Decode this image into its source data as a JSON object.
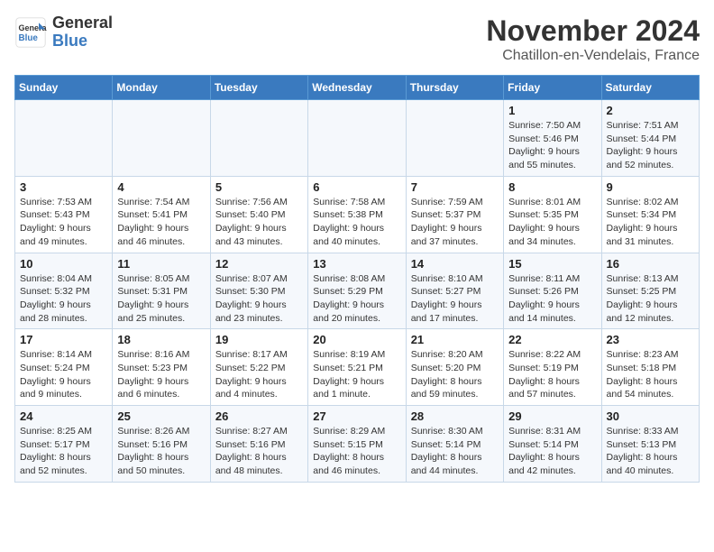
{
  "header": {
    "logo_line1": "General",
    "logo_line2": "Blue",
    "month": "November 2024",
    "location": "Chatillon-en-Vendelais, France"
  },
  "weekdays": [
    "Sunday",
    "Monday",
    "Tuesday",
    "Wednesday",
    "Thursday",
    "Friday",
    "Saturday"
  ],
  "weeks": [
    [
      {
        "day": "",
        "sunrise": "",
        "sunset": "",
        "daylight": ""
      },
      {
        "day": "",
        "sunrise": "",
        "sunset": "",
        "daylight": ""
      },
      {
        "day": "",
        "sunrise": "",
        "sunset": "",
        "daylight": ""
      },
      {
        "day": "",
        "sunrise": "",
        "sunset": "",
        "daylight": ""
      },
      {
        "day": "",
        "sunrise": "",
        "sunset": "",
        "daylight": ""
      },
      {
        "day": "1",
        "sunrise": "Sunrise: 7:50 AM",
        "sunset": "Sunset: 5:46 PM",
        "daylight": "Daylight: 9 hours and 55 minutes."
      },
      {
        "day": "2",
        "sunrise": "Sunrise: 7:51 AM",
        "sunset": "Sunset: 5:44 PM",
        "daylight": "Daylight: 9 hours and 52 minutes."
      }
    ],
    [
      {
        "day": "3",
        "sunrise": "Sunrise: 7:53 AM",
        "sunset": "Sunset: 5:43 PM",
        "daylight": "Daylight: 9 hours and 49 minutes."
      },
      {
        "day": "4",
        "sunrise": "Sunrise: 7:54 AM",
        "sunset": "Sunset: 5:41 PM",
        "daylight": "Daylight: 9 hours and 46 minutes."
      },
      {
        "day": "5",
        "sunrise": "Sunrise: 7:56 AM",
        "sunset": "Sunset: 5:40 PM",
        "daylight": "Daylight: 9 hours and 43 minutes."
      },
      {
        "day": "6",
        "sunrise": "Sunrise: 7:58 AM",
        "sunset": "Sunset: 5:38 PM",
        "daylight": "Daylight: 9 hours and 40 minutes."
      },
      {
        "day": "7",
        "sunrise": "Sunrise: 7:59 AM",
        "sunset": "Sunset: 5:37 PM",
        "daylight": "Daylight: 9 hours and 37 minutes."
      },
      {
        "day": "8",
        "sunrise": "Sunrise: 8:01 AM",
        "sunset": "Sunset: 5:35 PM",
        "daylight": "Daylight: 9 hours and 34 minutes."
      },
      {
        "day": "9",
        "sunrise": "Sunrise: 8:02 AM",
        "sunset": "Sunset: 5:34 PM",
        "daylight": "Daylight: 9 hours and 31 minutes."
      }
    ],
    [
      {
        "day": "10",
        "sunrise": "Sunrise: 8:04 AM",
        "sunset": "Sunset: 5:32 PM",
        "daylight": "Daylight: 9 hours and 28 minutes."
      },
      {
        "day": "11",
        "sunrise": "Sunrise: 8:05 AM",
        "sunset": "Sunset: 5:31 PM",
        "daylight": "Daylight: 9 hours and 25 minutes."
      },
      {
        "day": "12",
        "sunrise": "Sunrise: 8:07 AM",
        "sunset": "Sunset: 5:30 PM",
        "daylight": "Daylight: 9 hours and 23 minutes."
      },
      {
        "day": "13",
        "sunrise": "Sunrise: 8:08 AM",
        "sunset": "Sunset: 5:29 PM",
        "daylight": "Daylight: 9 hours and 20 minutes."
      },
      {
        "day": "14",
        "sunrise": "Sunrise: 8:10 AM",
        "sunset": "Sunset: 5:27 PM",
        "daylight": "Daylight: 9 hours and 17 minutes."
      },
      {
        "day": "15",
        "sunrise": "Sunrise: 8:11 AM",
        "sunset": "Sunset: 5:26 PM",
        "daylight": "Daylight: 9 hours and 14 minutes."
      },
      {
        "day": "16",
        "sunrise": "Sunrise: 8:13 AM",
        "sunset": "Sunset: 5:25 PM",
        "daylight": "Daylight: 9 hours and 12 minutes."
      }
    ],
    [
      {
        "day": "17",
        "sunrise": "Sunrise: 8:14 AM",
        "sunset": "Sunset: 5:24 PM",
        "daylight": "Daylight: 9 hours and 9 minutes."
      },
      {
        "day": "18",
        "sunrise": "Sunrise: 8:16 AM",
        "sunset": "Sunset: 5:23 PM",
        "daylight": "Daylight: 9 hours and 6 minutes."
      },
      {
        "day": "19",
        "sunrise": "Sunrise: 8:17 AM",
        "sunset": "Sunset: 5:22 PM",
        "daylight": "Daylight: 9 hours and 4 minutes."
      },
      {
        "day": "20",
        "sunrise": "Sunrise: 8:19 AM",
        "sunset": "Sunset: 5:21 PM",
        "daylight": "Daylight: 9 hours and 1 minute."
      },
      {
        "day": "21",
        "sunrise": "Sunrise: 8:20 AM",
        "sunset": "Sunset: 5:20 PM",
        "daylight": "Daylight: 8 hours and 59 minutes."
      },
      {
        "day": "22",
        "sunrise": "Sunrise: 8:22 AM",
        "sunset": "Sunset: 5:19 PM",
        "daylight": "Daylight: 8 hours and 57 minutes."
      },
      {
        "day": "23",
        "sunrise": "Sunrise: 8:23 AM",
        "sunset": "Sunset: 5:18 PM",
        "daylight": "Daylight: 8 hours and 54 minutes."
      }
    ],
    [
      {
        "day": "24",
        "sunrise": "Sunrise: 8:25 AM",
        "sunset": "Sunset: 5:17 PM",
        "daylight": "Daylight: 8 hours and 52 minutes."
      },
      {
        "day": "25",
        "sunrise": "Sunrise: 8:26 AM",
        "sunset": "Sunset: 5:16 PM",
        "daylight": "Daylight: 8 hours and 50 minutes."
      },
      {
        "day": "26",
        "sunrise": "Sunrise: 8:27 AM",
        "sunset": "Sunset: 5:16 PM",
        "daylight": "Daylight: 8 hours and 48 minutes."
      },
      {
        "day": "27",
        "sunrise": "Sunrise: 8:29 AM",
        "sunset": "Sunset: 5:15 PM",
        "daylight": "Daylight: 8 hours and 46 minutes."
      },
      {
        "day": "28",
        "sunrise": "Sunrise: 8:30 AM",
        "sunset": "Sunset: 5:14 PM",
        "daylight": "Daylight: 8 hours and 44 minutes."
      },
      {
        "day": "29",
        "sunrise": "Sunrise: 8:31 AM",
        "sunset": "Sunset: 5:14 PM",
        "daylight": "Daylight: 8 hours and 42 minutes."
      },
      {
        "day": "30",
        "sunrise": "Sunrise: 8:33 AM",
        "sunset": "Sunset: 5:13 PM",
        "daylight": "Daylight: 8 hours and 40 minutes."
      }
    ]
  ]
}
